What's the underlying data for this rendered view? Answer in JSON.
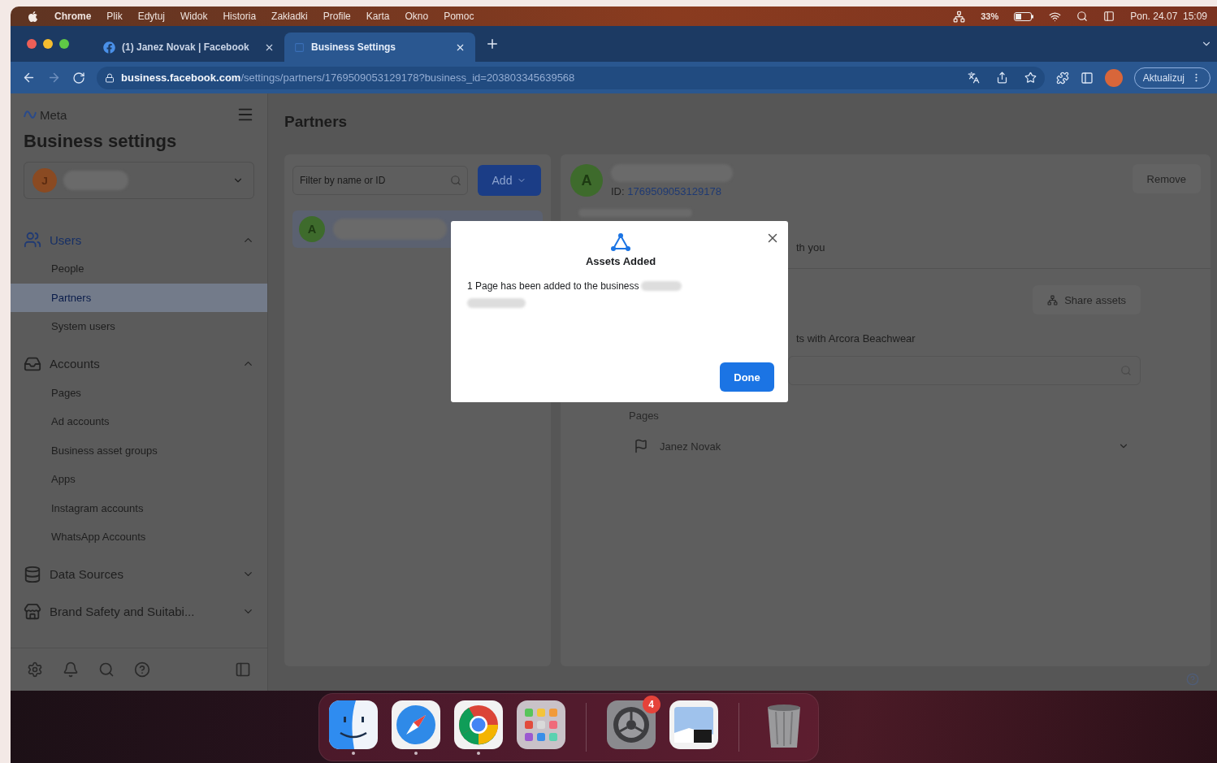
{
  "menu_bar": {
    "app": "Chrome",
    "menus": [
      "Plik",
      "Edytuj",
      "Widok",
      "Historia",
      "Zakładki",
      "Profile",
      "Karta",
      "Okno",
      "Pomoc"
    ],
    "battery": "33%",
    "clock": "Pon. 24.07  15:09"
  },
  "browser": {
    "tabs": [
      {
        "title": "(1) Janez Novak | Facebook",
        "selected": false
      },
      {
        "title": "Business Settings",
        "selected": true
      }
    ],
    "url_host": "business.facebook.com",
    "url_path": "/settings/partners/1769509053129178?business_id=203803345639568",
    "update_button": "Aktualizuj"
  },
  "sidebar": {
    "brand": "Meta",
    "title": "Business settings",
    "account_initial": "J",
    "sections": [
      {
        "kind": "users",
        "label": "Users",
        "expanded": true,
        "items": [
          {
            "label": "People",
            "selected": false
          },
          {
            "label": "Partners",
            "selected": true
          },
          {
            "label": "System users",
            "selected": false
          }
        ]
      },
      {
        "kind": "accounts",
        "label": "Accounts",
        "expanded": true,
        "items": [
          {
            "label": "Pages",
            "selected": false
          },
          {
            "label": "Ad accounts",
            "selected": false
          },
          {
            "label": "Business asset groups",
            "selected": false
          },
          {
            "label": "Apps",
            "selected": false
          },
          {
            "label": "Instagram accounts",
            "selected": false
          },
          {
            "label": "WhatsApp Accounts",
            "selected": false
          }
        ]
      },
      {
        "kind": "data",
        "label": "Data Sources",
        "expanded": false
      },
      {
        "kind": "brand",
        "label": "Brand Safety and Suitabi...",
        "expanded": false
      }
    ]
  },
  "partners": {
    "heading": "Partners",
    "filter_placeholder": "Filter by name or ID",
    "add_button": "Add",
    "list": [
      {
        "initial": "A",
        "selected": true
      }
    ],
    "detail": {
      "initial": "A",
      "id_label": "ID:",
      "id": "1769509053129178",
      "remove_button": "Remove",
      "shared_fragment": "th you",
      "share_button": "Share assets",
      "assets_fragment": "ts with Arcora Beachwear",
      "pages_label": "Pages",
      "pages": [
        {
          "name": "Janez Novak"
        }
      ]
    }
  },
  "dialog": {
    "title": "Assets Added",
    "message": "1 Page has been added to the business",
    "done_button": "Done"
  },
  "dock": [
    {
      "kind": "finder",
      "running": true,
      "separator_before": false
    },
    {
      "kind": "safari",
      "running": true,
      "separator_before": false
    },
    {
      "kind": "chrome",
      "running": true,
      "separator_before": false
    },
    {
      "kind": "launchpad",
      "running": false,
      "separator_before": false
    },
    {
      "kind": "settings",
      "running": false,
      "separator_before": true,
      "badge": "4"
    },
    {
      "kind": "preview",
      "running": false,
      "separator_before": false
    },
    {
      "kind": "trash",
      "running": false,
      "separator_before": true
    }
  ]
}
